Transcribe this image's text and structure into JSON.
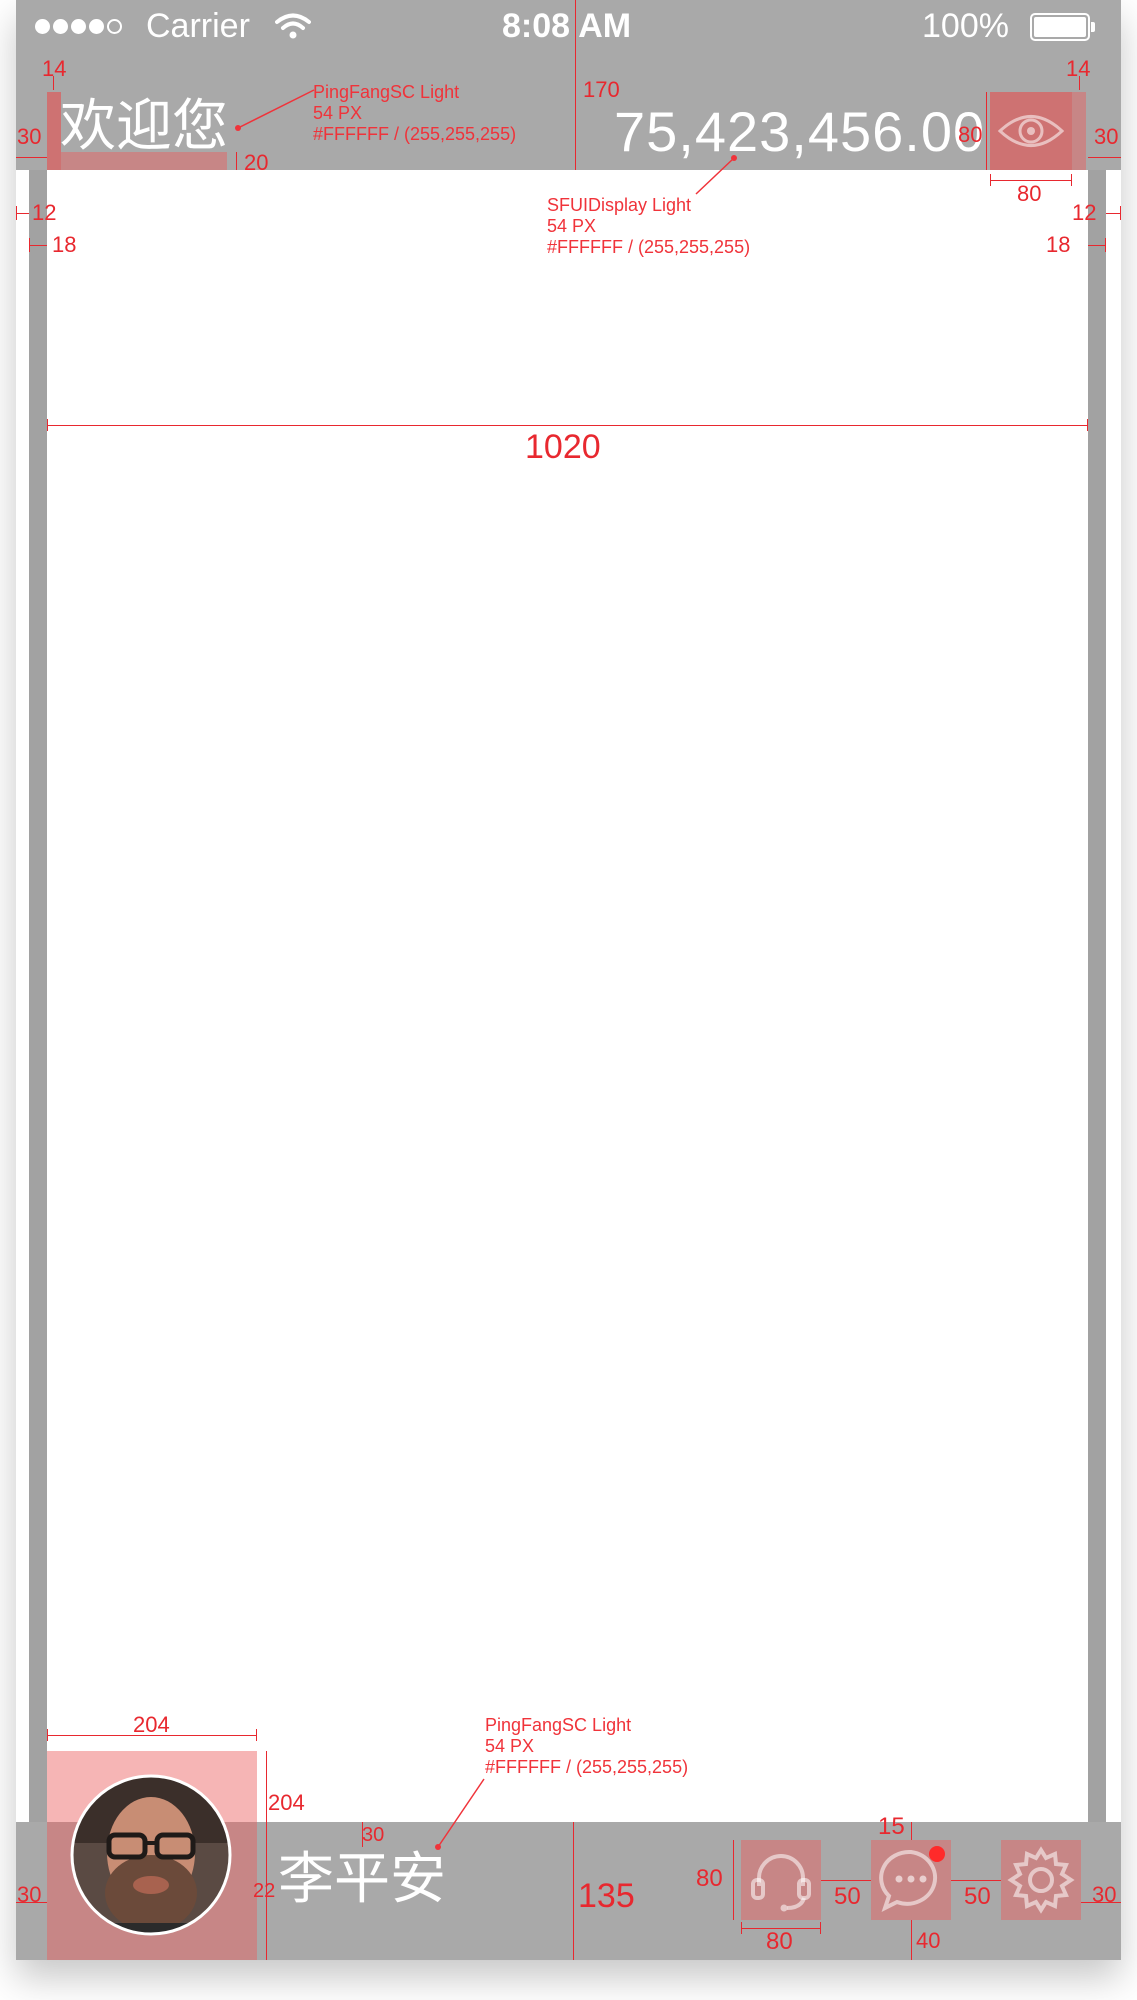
{
  "status_bar": {
    "carrier": "Carrier",
    "time": "8:08 AM",
    "battery": "100%"
  },
  "header": {
    "greeting": "欢迎您",
    "balance": "75,423,456.00",
    "eye_icon": "eye-icon"
  },
  "annotations": {
    "greeting_font": "PingFangSC Light\n54 PX\n#FFFFFF / (255,255,255)",
    "balance_font": "SFUIDisplay Light\n54 PX\n#FFFFFF / (255,255,255)",
    "name_font": "PingFangSC Light\n54 PX\n#FFFFFF / (255,255,255)",
    "d14_left": "14",
    "d14_right": "14",
    "d30_left": "30",
    "d30_right": "30",
    "d20": "20",
    "d170": "170",
    "d80_eye_h": "80",
    "d80_eye_w": "80",
    "d12_left": "12",
    "d12_right": "12",
    "d18_left": "18",
    "d18_right": "18",
    "content_width": "1020",
    "avatar_w": "204",
    "avatar_h": "204",
    "d30_name": "30",
    "d22": "22",
    "d135": "135",
    "d30_bottom_left": "30",
    "d30_bottom_right": "30",
    "icon_h": "80",
    "icon_w": "80",
    "gap1": "50",
    "gap2": "50",
    "d15": "15",
    "d40": "40"
  },
  "footer": {
    "user_name": "李平安",
    "icons": [
      "headset-icon",
      "chat-icon",
      "gear-icon"
    ]
  },
  "colors": {
    "chrome": "#a9a9a9",
    "annotation": "#f0333a",
    "text": "#ffffff"
  }
}
